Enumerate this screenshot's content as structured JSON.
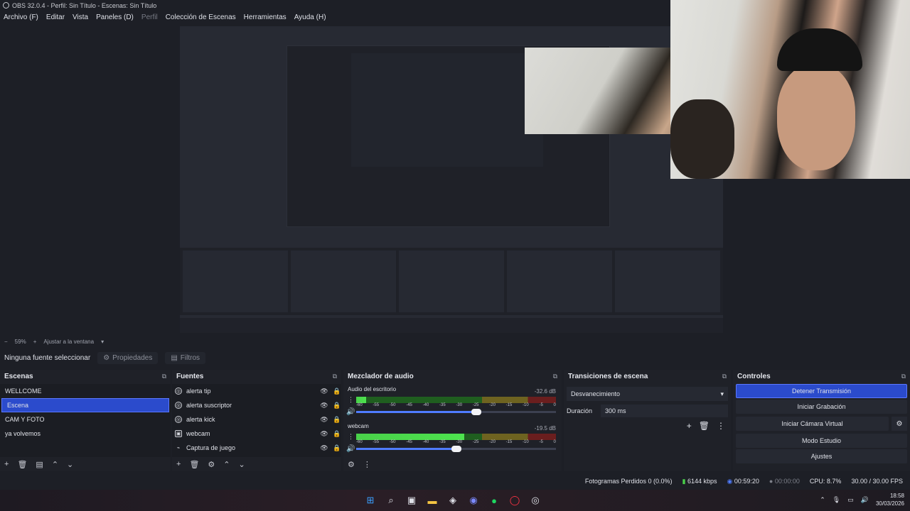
{
  "window": {
    "title": "OBS 32.0.4 - Perfil: Sin Título - Escenas: Sin Título"
  },
  "menu": [
    {
      "label": "Archivo (F)"
    },
    {
      "label": "Editar"
    },
    {
      "label": "Vista"
    },
    {
      "label": "Paneles (D)"
    },
    {
      "label": "Perfil"
    },
    {
      "label": "Colección de Escenas"
    },
    {
      "label": "Herramientas"
    },
    {
      "label": "Ayuda (H)"
    }
  ],
  "zoom": {
    "value": "59%",
    "fit_label": "Ajustar a la ventana"
  },
  "context": {
    "no_source": "Ninguna fuente seleccionar",
    "properties": "Propiedades",
    "filters": "Filtros"
  },
  "docks": {
    "scenes": {
      "title": "Escenas",
      "items": [
        "WELLCOME",
        "Escena",
        "CAM Y FOTO",
        "ya volvemos"
      ]
    },
    "sources": {
      "title": "Fuentes",
      "items": [
        "alerta tip",
        "alerta suscriptor",
        "alerta kick",
        "webcam",
        "Captura de juego"
      ]
    },
    "mixer": {
      "title": "Mezclador de audio",
      "channels": [
        {
          "name": "Audio del escritorio",
          "db": "-32.6 dB",
          "level": 0.05,
          "volume": 0.6
        },
        {
          "name": "webcam",
          "db": "-19.5 dB",
          "level": 0.54,
          "volume": 0.5
        }
      ],
      "ticks": [
        "-60",
        "-55",
        "-50",
        "-45",
        "-40",
        "-35",
        "-30",
        "-25",
        "-20",
        "-15",
        "-10",
        "-5",
        "0"
      ]
    },
    "transitions": {
      "title": "Transiciones de escena",
      "selected": "Desvanecimiento",
      "duration_label": "Duración",
      "duration_value": "300 ms"
    },
    "controls": {
      "title": "Controles",
      "stop_stream": "Detener Transmisión",
      "start_record": "Iniciar Grabación",
      "start_virtualcam": "Iniciar Cámara Virtual",
      "studio_mode": "Modo Estudio",
      "settings": "Ajustes"
    }
  },
  "status": {
    "dropped": "Fotogramas Perdidos 0 (0.0%)",
    "bitrate": "6144 kbps",
    "stream_time": "00:59:20",
    "record_time": "00:00:00",
    "cpu": "CPU: 8.7%",
    "fps": "30.00 / 30.00 FPS"
  },
  "clock": {
    "time": "18:58",
    "date": "30/03/2026"
  }
}
